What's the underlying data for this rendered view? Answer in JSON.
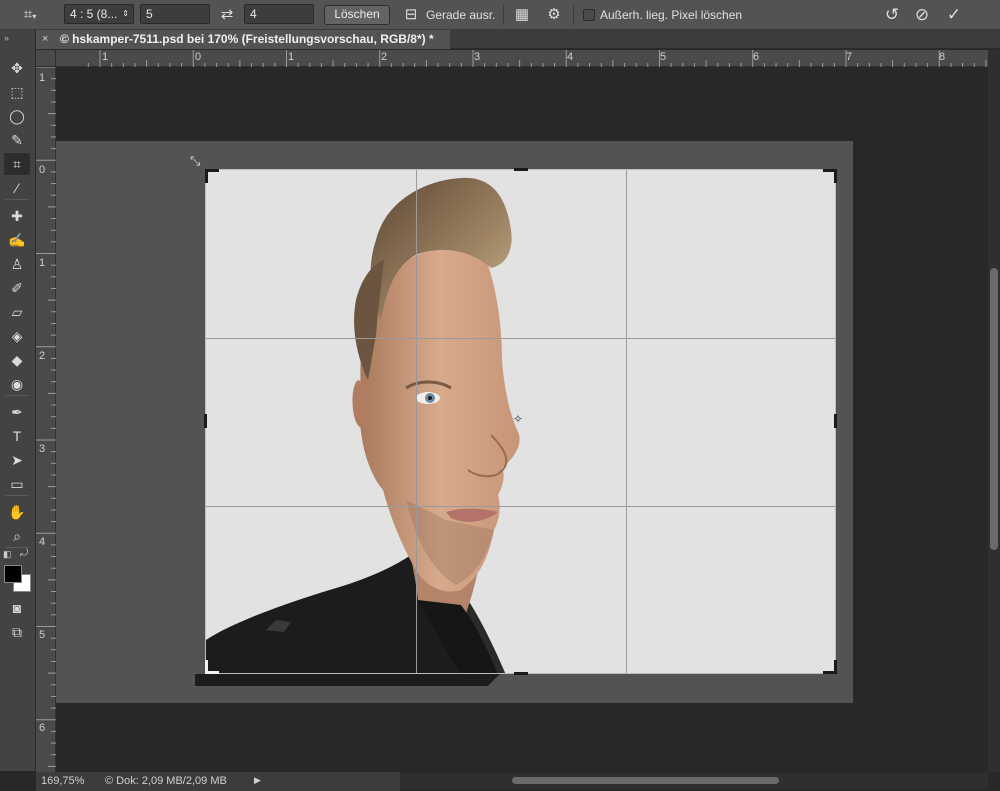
{
  "options_bar": {
    "ratio_label": "4 : 5 (8...",
    "width_value": "5",
    "height_value": "4",
    "clear_button": "Löschen",
    "straighten_label": "Gerade ausr.",
    "delete_cropped_label": "Außerh. lieg. Pixel löschen"
  },
  "document_tab": {
    "title": "© hskamper-7511.psd bei 170% (Freistellungsvorschau, RGB/8*) *",
    "close_glyph": "×"
  },
  "tools": [
    {
      "name": "move-tool",
      "glyph": "✥"
    },
    {
      "name": "rect-marquee-tool",
      "glyph": "⬚"
    },
    {
      "name": "lasso-tool",
      "glyph": "◯"
    },
    {
      "name": "quick-select-tool",
      "glyph": "✎"
    },
    {
      "name": "crop-tool",
      "glyph": "⌗"
    },
    {
      "name": "eyedropper-tool",
      "glyph": "⁄"
    },
    {
      "name": "healing-brush-tool",
      "glyph": "✚"
    },
    {
      "name": "brush-tool",
      "glyph": "✍"
    },
    {
      "name": "clone-stamp-tool",
      "glyph": "♙"
    },
    {
      "name": "history-brush-tool",
      "glyph": "✐"
    },
    {
      "name": "eraser-tool",
      "glyph": "▱"
    },
    {
      "name": "paint-bucket-tool",
      "glyph": "◈"
    },
    {
      "name": "blur-tool",
      "glyph": "◆"
    },
    {
      "name": "dodge-tool",
      "glyph": "◉"
    },
    {
      "name": "pen-tool",
      "glyph": "✒"
    },
    {
      "name": "type-tool",
      "glyph": "T"
    },
    {
      "name": "path-select-tool",
      "glyph": "➤"
    },
    {
      "name": "rectangle-tool",
      "glyph": "▭"
    },
    {
      "name": "hand-tool",
      "glyph": "✋"
    },
    {
      "name": "zoom-tool",
      "glyph": "⌕"
    }
  ],
  "ruler": {
    "h_labels": [
      "1",
      "0",
      "1",
      "2",
      "3",
      "4",
      "5",
      "6",
      "7",
      "8"
    ],
    "v_labels": [
      "1",
      "0",
      "1",
      "2",
      "3",
      "4",
      "5",
      "6"
    ]
  },
  "status": {
    "zoom": "169,75%",
    "doc_size": "© Dok: 2,09 MB/2,09 MB"
  },
  "colors": {
    "foreground": "#000000",
    "background": "#ffffff"
  }
}
